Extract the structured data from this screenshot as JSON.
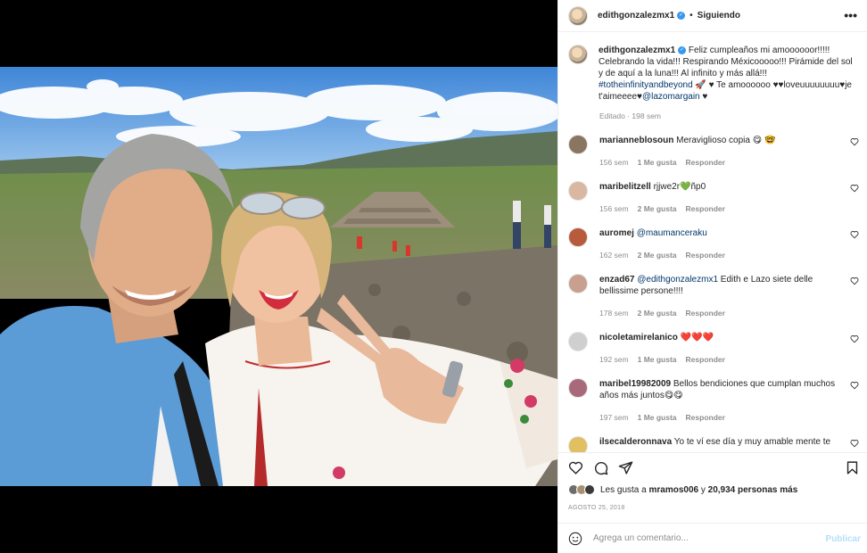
{
  "post": {
    "username": "edithgonzalezmx1",
    "follow_status": "Siguiendo",
    "more_glyph": "•••",
    "separator": "•"
  },
  "caption": {
    "username": "edithgonzalezmx1",
    "text_1": " Feliz cumpleaños mi amoooooor!!!!! Celebrando la vida!!! Respirando Méxicooooo!!! Pirámide del sol y de aquí a la luna!!! Al infinito y más allá!!! ",
    "hashtag": "#totheinfinityandbeyond",
    "text_2": " 🚀 ♥ Te amoooooo ♥♥loveuuuuuuuu♥je t'aimeeee♥",
    "mention": "@lazomargain",
    "text_3": " ♥",
    "edited": "Editado",
    "time": "198 sem"
  },
  "comments": [
    {
      "username": "marianneblosoun",
      "text": "Meraviglioso copia 😋 🤓",
      "time": "156 sem",
      "likes": "1 Me gusta",
      "reply": "Responder",
      "avatar_color": "#8a7560"
    },
    {
      "username": "maribelitzell",
      "text": "rjjwe2r💚ñp0",
      "time": "156 sem",
      "likes": "2 Me gusta",
      "reply": "Responder",
      "avatar_color": "#d9b7a0"
    },
    {
      "username": "auromej",
      "text": "",
      "mention": "@maumanceraku",
      "time": "162 sem",
      "likes": "2 Me gusta",
      "reply": "Responder",
      "avatar_color": "#b85a3c"
    },
    {
      "username": "enzad67",
      "text": " Edith e Lazo siete delle bellissime persone!!!!",
      "mention": "@edithgonzalezmx1",
      "time": "178 sem",
      "likes": "2 Me gusta",
      "reply": "Responder",
      "avatar_color": "#c9a090"
    },
    {
      "username": "nicoletamirelanico",
      "text": "❤️❤️❤️",
      "time": "192 sem",
      "likes": "1 Me gusta",
      "reply": "Responder",
      "avatar_color": "#cfcfcf"
    },
    {
      "username": "maribel19982009",
      "text": "Bellos bendiciones que cumplan muchos años más juntos😋😋",
      "time": "197 sem",
      "likes": "1 Me gusta",
      "reply": "Responder",
      "avatar_color": "#a86a7a"
    },
    {
      "username": "ilsecalderonnava",
      "text": "Yo te ví ese día y muy amable mente te",
      "avatar_color": "#e0c060"
    }
  ],
  "likes": {
    "prefix": "Les gusta a ",
    "user": "mramos006",
    "middle": " y ",
    "count": "20,934 personas más"
  },
  "date": "AGOSTO 25, 2018",
  "add_comment": {
    "placeholder": "Agrega un comentario...",
    "publish": "Publicar"
  },
  "colors": {
    "link": "#00376b",
    "verified": "#3897f0",
    "publish_disabled": "#b2dffc",
    "meta": "#8e8e8e"
  }
}
